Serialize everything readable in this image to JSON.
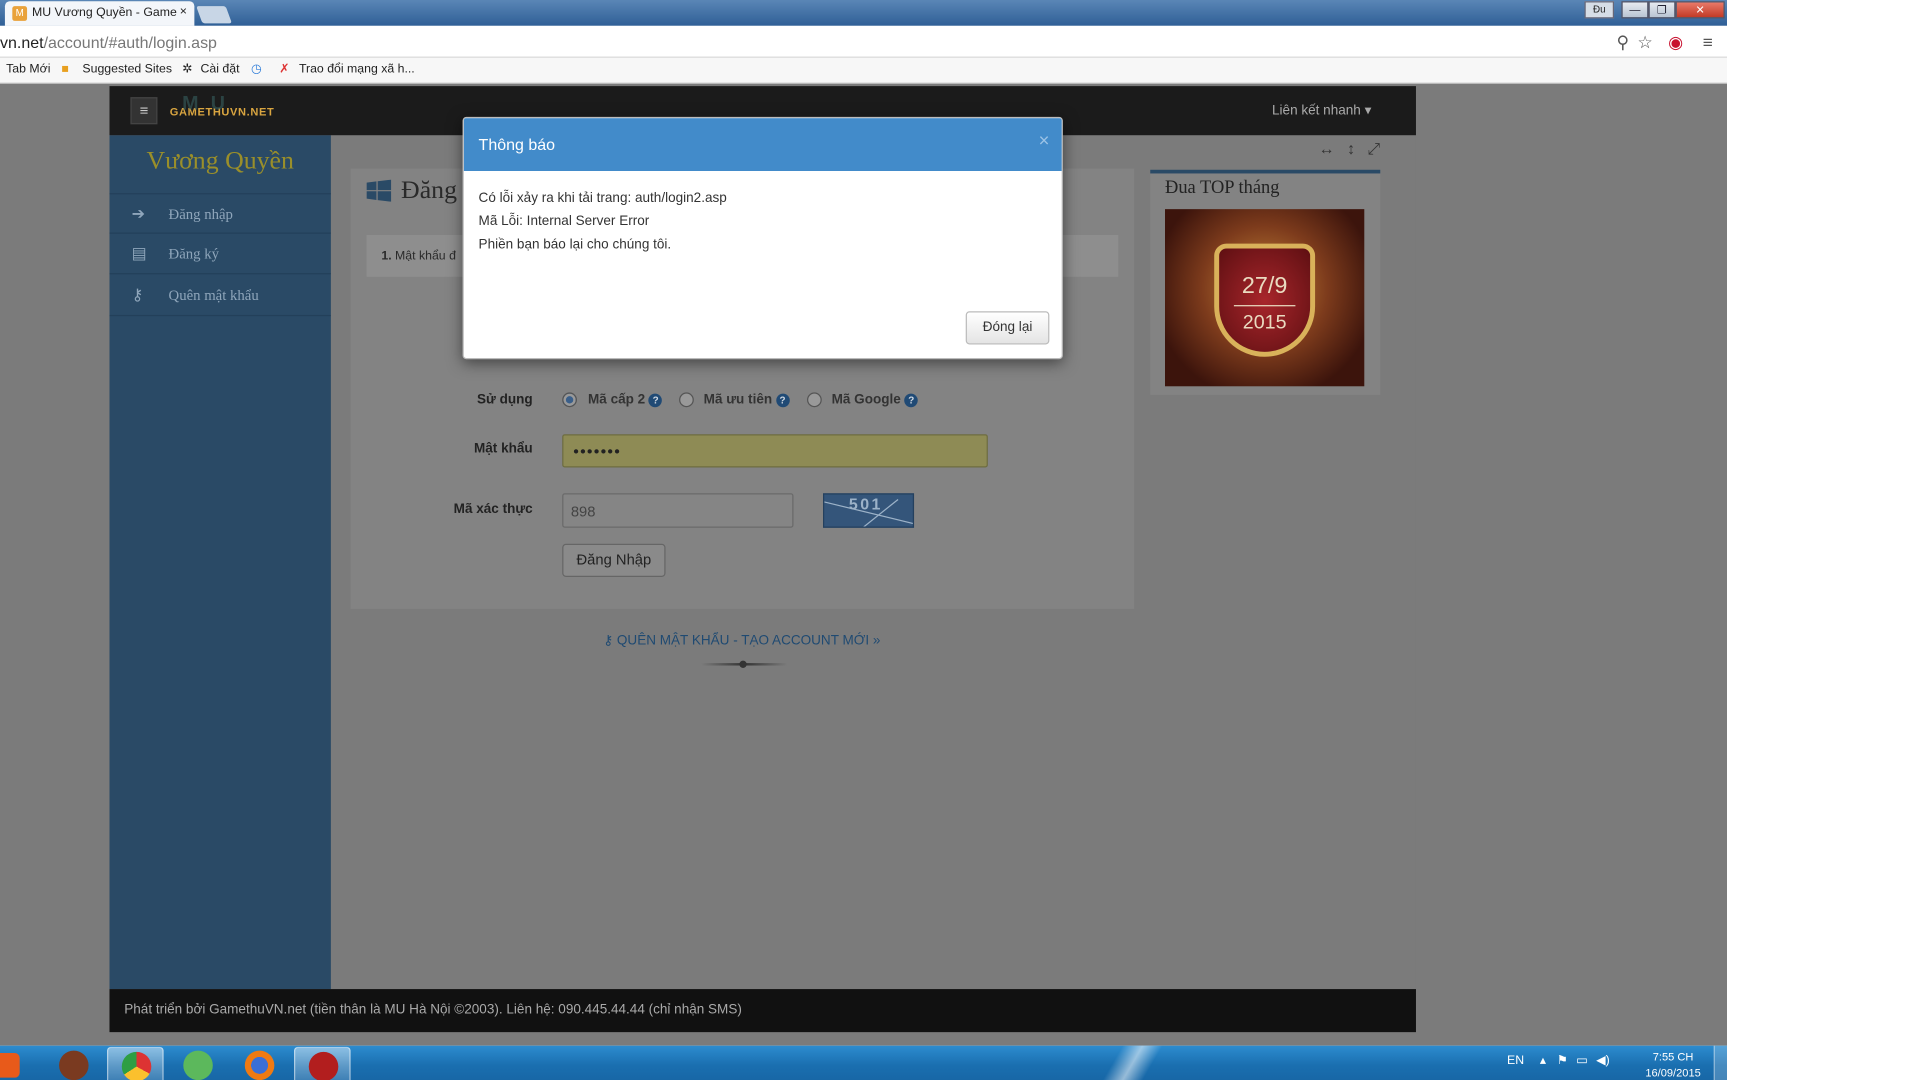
{
  "browser": {
    "tab_title": "MU Vương Quyền - Game",
    "tab_close": "×",
    "window_user": "Đu",
    "window_buttons": {
      "minimize": "—",
      "restore": "❐",
      "close": "✕"
    },
    "url_host": "vn.net",
    "url_path": "/account/#auth/login.asp",
    "bookmarks": [
      "Tab Mới",
      "Suggested Sites",
      "Cài đặt",
      "Trao đổi mạng xã h..."
    ]
  },
  "site": {
    "logo_text": "GAMETHUVN.NET",
    "logo_mu": "MU",
    "quick_links": "Liên kết nhanh",
    "brand": "Vương Quyền",
    "sidebar": [
      {
        "label": "Đăng nhập",
        "icon": "sign-in-icon"
      },
      {
        "label": "Đăng ký",
        "icon": "document-icon"
      },
      {
        "label": "Quên mật khẩu",
        "icon": "key-icon"
      }
    ],
    "tools": [
      "↔",
      "↕",
      "⤢"
    ],
    "card_title": "Đăng",
    "step_num": "1.",
    "step_text": "Mật khẩu đ",
    "form": {
      "use_label": "Sử dụng",
      "options": [
        "Mã cấp 2",
        "Mã ưu tiên",
        "Mã Google"
      ],
      "selected_option": "Mã cấp 2",
      "password_label": "Mật khẩu",
      "password_value": "•••••••",
      "captcha_label": "Mã xác thực",
      "captcha_value": "898",
      "captcha_image_text": "501",
      "submit": "Đăng Nhập"
    },
    "links": "QUÊN MẬT KHẨU - TẠO ACCOUNT MỚI »",
    "top_title": "Đua TOP tháng",
    "top_badge_date": "27/9",
    "top_badge_year": "2015",
    "footer": "Phát triển bởi GamethuVN.net (tiền thân là MU Hà Nội ©2003). Liên hệ: 090.445.44.44 (chỉ nhận SMS)"
  },
  "modal": {
    "title": "Thông báo",
    "close": "×",
    "lines": [
      "Có lỗi xảy ra khi tải trang: auth/login2.asp",
      "Mã Lỗi: Internal Server Error",
      "Phiền bạn báo lại cho chúng tôi."
    ],
    "button": "Đóng lại"
  },
  "taskbar": {
    "lang": "EN",
    "time": "7:55 CH",
    "date": "16/09/2015"
  },
  "colors": {
    "modal_header": "#428bca",
    "sidebar": "#2a4a66",
    "header": "#1b1b1b"
  }
}
